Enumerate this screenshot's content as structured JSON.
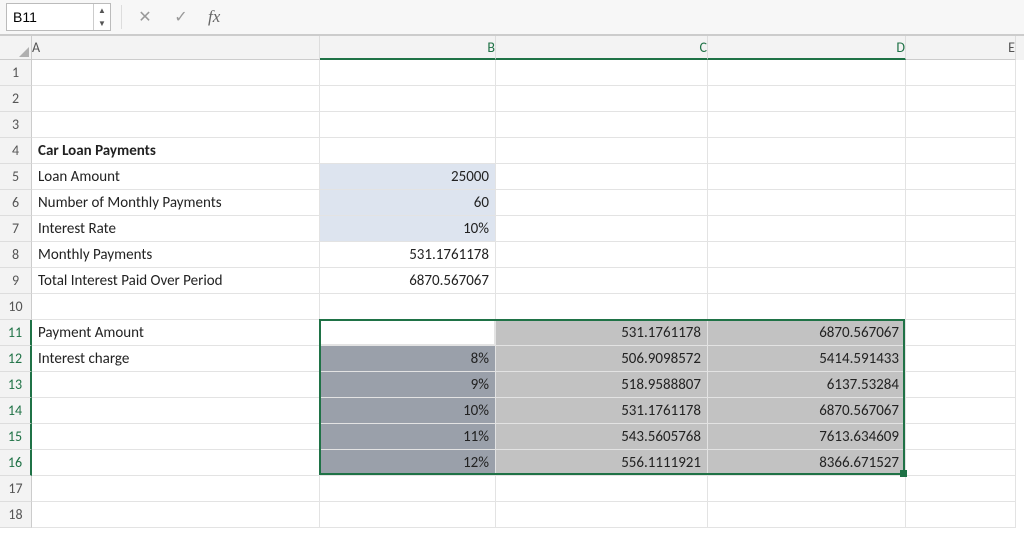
{
  "namebox": {
    "value": "B11"
  },
  "formula_bar": {
    "cancel_glyph": "✕",
    "enter_glyph": "✓",
    "fx_label": "fx",
    "input_value": ""
  },
  "columns": [
    "A",
    "B",
    "C",
    "D",
    "E"
  ],
  "row_count": 18,
  "selected_cols": [
    "B",
    "C",
    "D"
  ],
  "selected_rows": [
    11,
    12,
    13,
    14,
    15,
    16
  ],
  "cells": {
    "A4": "Car Loan Payments",
    "A5": "Loan Amount",
    "B5": "25000",
    "A6": "Number of Monthly Payments",
    "B6": "60",
    "A7": "Interest Rate",
    "B7": "10%",
    "A8": "Monthly Payments",
    "B8": "531.1761178",
    "A9": "Total Interest Paid Over Period",
    "B9": "6870.567067",
    "A11": "Payment Amount",
    "C11": "531.1761178",
    "D11": "6870.567067",
    "A12": "Interest charge",
    "B12": "8%",
    "C12": "506.9098572",
    "D12": "5414.591433",
    "B13": "9%",
    "C13": "518.9588807",
    "D13": "6137.53284",
    "B14": "10%",
    "C14": "531.1761178",
    "D14": "6870.567067",
    "B15": "11%",
    "C15": "543.5605768",
    "D15": "7613.634609",
    "B16": "12%",
    "C16": "556.1111921",
    "D16": "8366.671527"
  },
  "chart_data": {
    "type": "table",
    "title": "Car Loan Payments",
    "inputs": {
      "loan_amount": 25000,
      "num_monthly_payments": 60,
      "interest_rate": 0.1,
      "monthly_payments": 531.1761178,
      "total_interest_paid": 6870.567067
    },
    "data_table": {
      "input_label": "Interest charge",
      "outputs": [
        "Payment Amount",
        "Total Interest"
      ],
      "base": {
        "payment": 531.1761178,
        "total_interest": 6870.567067
      },
      "rows": [
        {
          "rate": 0.08,
          "payment": 506.9098572,
          "total_interest": 5414.591433
        },
        {
          "rate": 0.09,
          "payment": 518.9588807,
          "total_interest": 6137.53284
        },
        {
          "rate": 0.1,
          "payment": 531.1761178,
          "total_interest": 6870.567067
        },
        {
          "rate": 0.11,
          "payment": 543.5605768,
          "total_interest": 7613.634609
        },
        {
          "rate": 0.12,
          "payment": 556.1111921,
          "total_interest": 8366.671527
        }
      ]
    }
  }
}
